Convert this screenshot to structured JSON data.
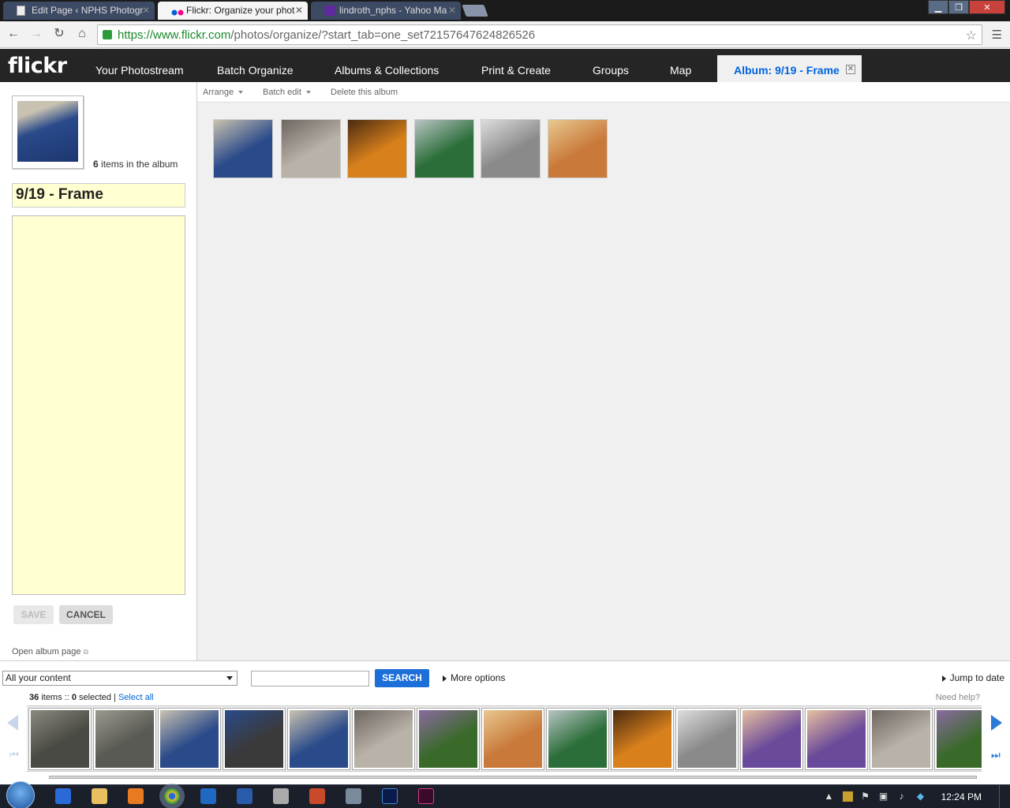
{
  "browser": {
    "tabs": [
      {
        "title": "Edit Page ‹ NPHS Photogr"
      },
      {
        "title": "Flickr: Organize your phot"
      },
      {
        "title": "lindroth_nphs - Yahoo Ma"
      }
    ],
    "url_host": "https://www.flickr.com",
    "url_path": "/photos/organize/?start_tab=one_set72157647624826526"
  },
  "flickr": {
    "logo": "flickr",
    "nav": {
      "photostream": "Your Photostream",
      "batch": "Batch Organize",
      "albums": "Albums & Collections",
      "print": "Print & Create",
      "groups": "Groups",
      "map": "Map",
      "active_tab": "Album: 9/19 - Frame"
    },
    "subbar": {
      "arrange": "Arrange",
      "batch_edit": "Batch edit",
      "delete": "Delete this album"
    },
    "album": {
      "item_count": "6",
      "items_label": "items in the album",
      "title": "9/19 - Frame",
      "description": "",
      "save": "SAVE",
      "cancel": "CANCEL",
      "open_link": "Open album page"
    },
    "album_photos": [
      {
        "color": "#2a4a8a",
        "accent": "#c9c2b0"
      },
      {
        "color": "#b9b2a8",
        "accent": "#6d6560"
      },
      {
        "color": "#d8801c",
        "accent": "#4a2a10"
      },
      {
        "color": "#2c6e3a",
        "accent": "#b8c4c4"
      },
      {
        "color": "#8a8a8a",
        "accent": "#dddddd"
      },
      {
        "color": "#c97a3a",
        "accent": "#e8c890"
      }
    ],
    "bottom": {
      "filter": "All your content",
      "search_value": "",
      "search_button": "SEARCH",
      "more_options": "More options",
      "jump_to_date": "Jump to date",
      "total": "36",
      "items_label": "items ::",
      "selected": "0",
      "selected_label": "selected |",
      "select_all": "Select all",
      "need_help": "Need help?"
    },
    "strip_photos": [
      {
        "color": "#4a4a44",
        "accent": "#8a8a80"
      },
      {
        "color": "#5a5a54",
        "accent": "#9a9a90"
      },
      {
        "color": "#2a4a8a",
        "accent": "#c9c2b0"
      },
      {
        "color": "#3a3a3a",
        "accent": "#2a4a8a"
      },
      {
        "color": "#2a4a8a",
        "accent": "#c9c2b0"
      },
      {
        "color": "#b9b2a8",
        "accent": "#6d6560"
      },
      {
        "color": "#3a6a2a",
        "accent": "#8a6aa0"
      },
      {
        "color": "#c97a3a",
        "accent": "#e8c890"
      },
      {
        "color": "#2c6e3a",
        "accent": "#b8c4c4"
      },
      {
        "color": "#d8801c",
        "accent": "#4a2a10"
      },
      {
        "color": "#8a8a8a",
        "accent": "#dddddd"
      },
      {
        "color": "#6a4a9a",
        "accent": "#e8c0a0"
      },
      {
        "color": "#6a4a9a",
        "accent": "#e8c0a0"
      },
      {
        "color": "#b9b2a8",
        "accent": "#6d6560"
      },
      {
        "color": "#3a6a2a",
        "accent": "#8a6aa0"
      }
    ]
  },
  "taskbar": {
    "clock": "12:24 PM"
  }
}
